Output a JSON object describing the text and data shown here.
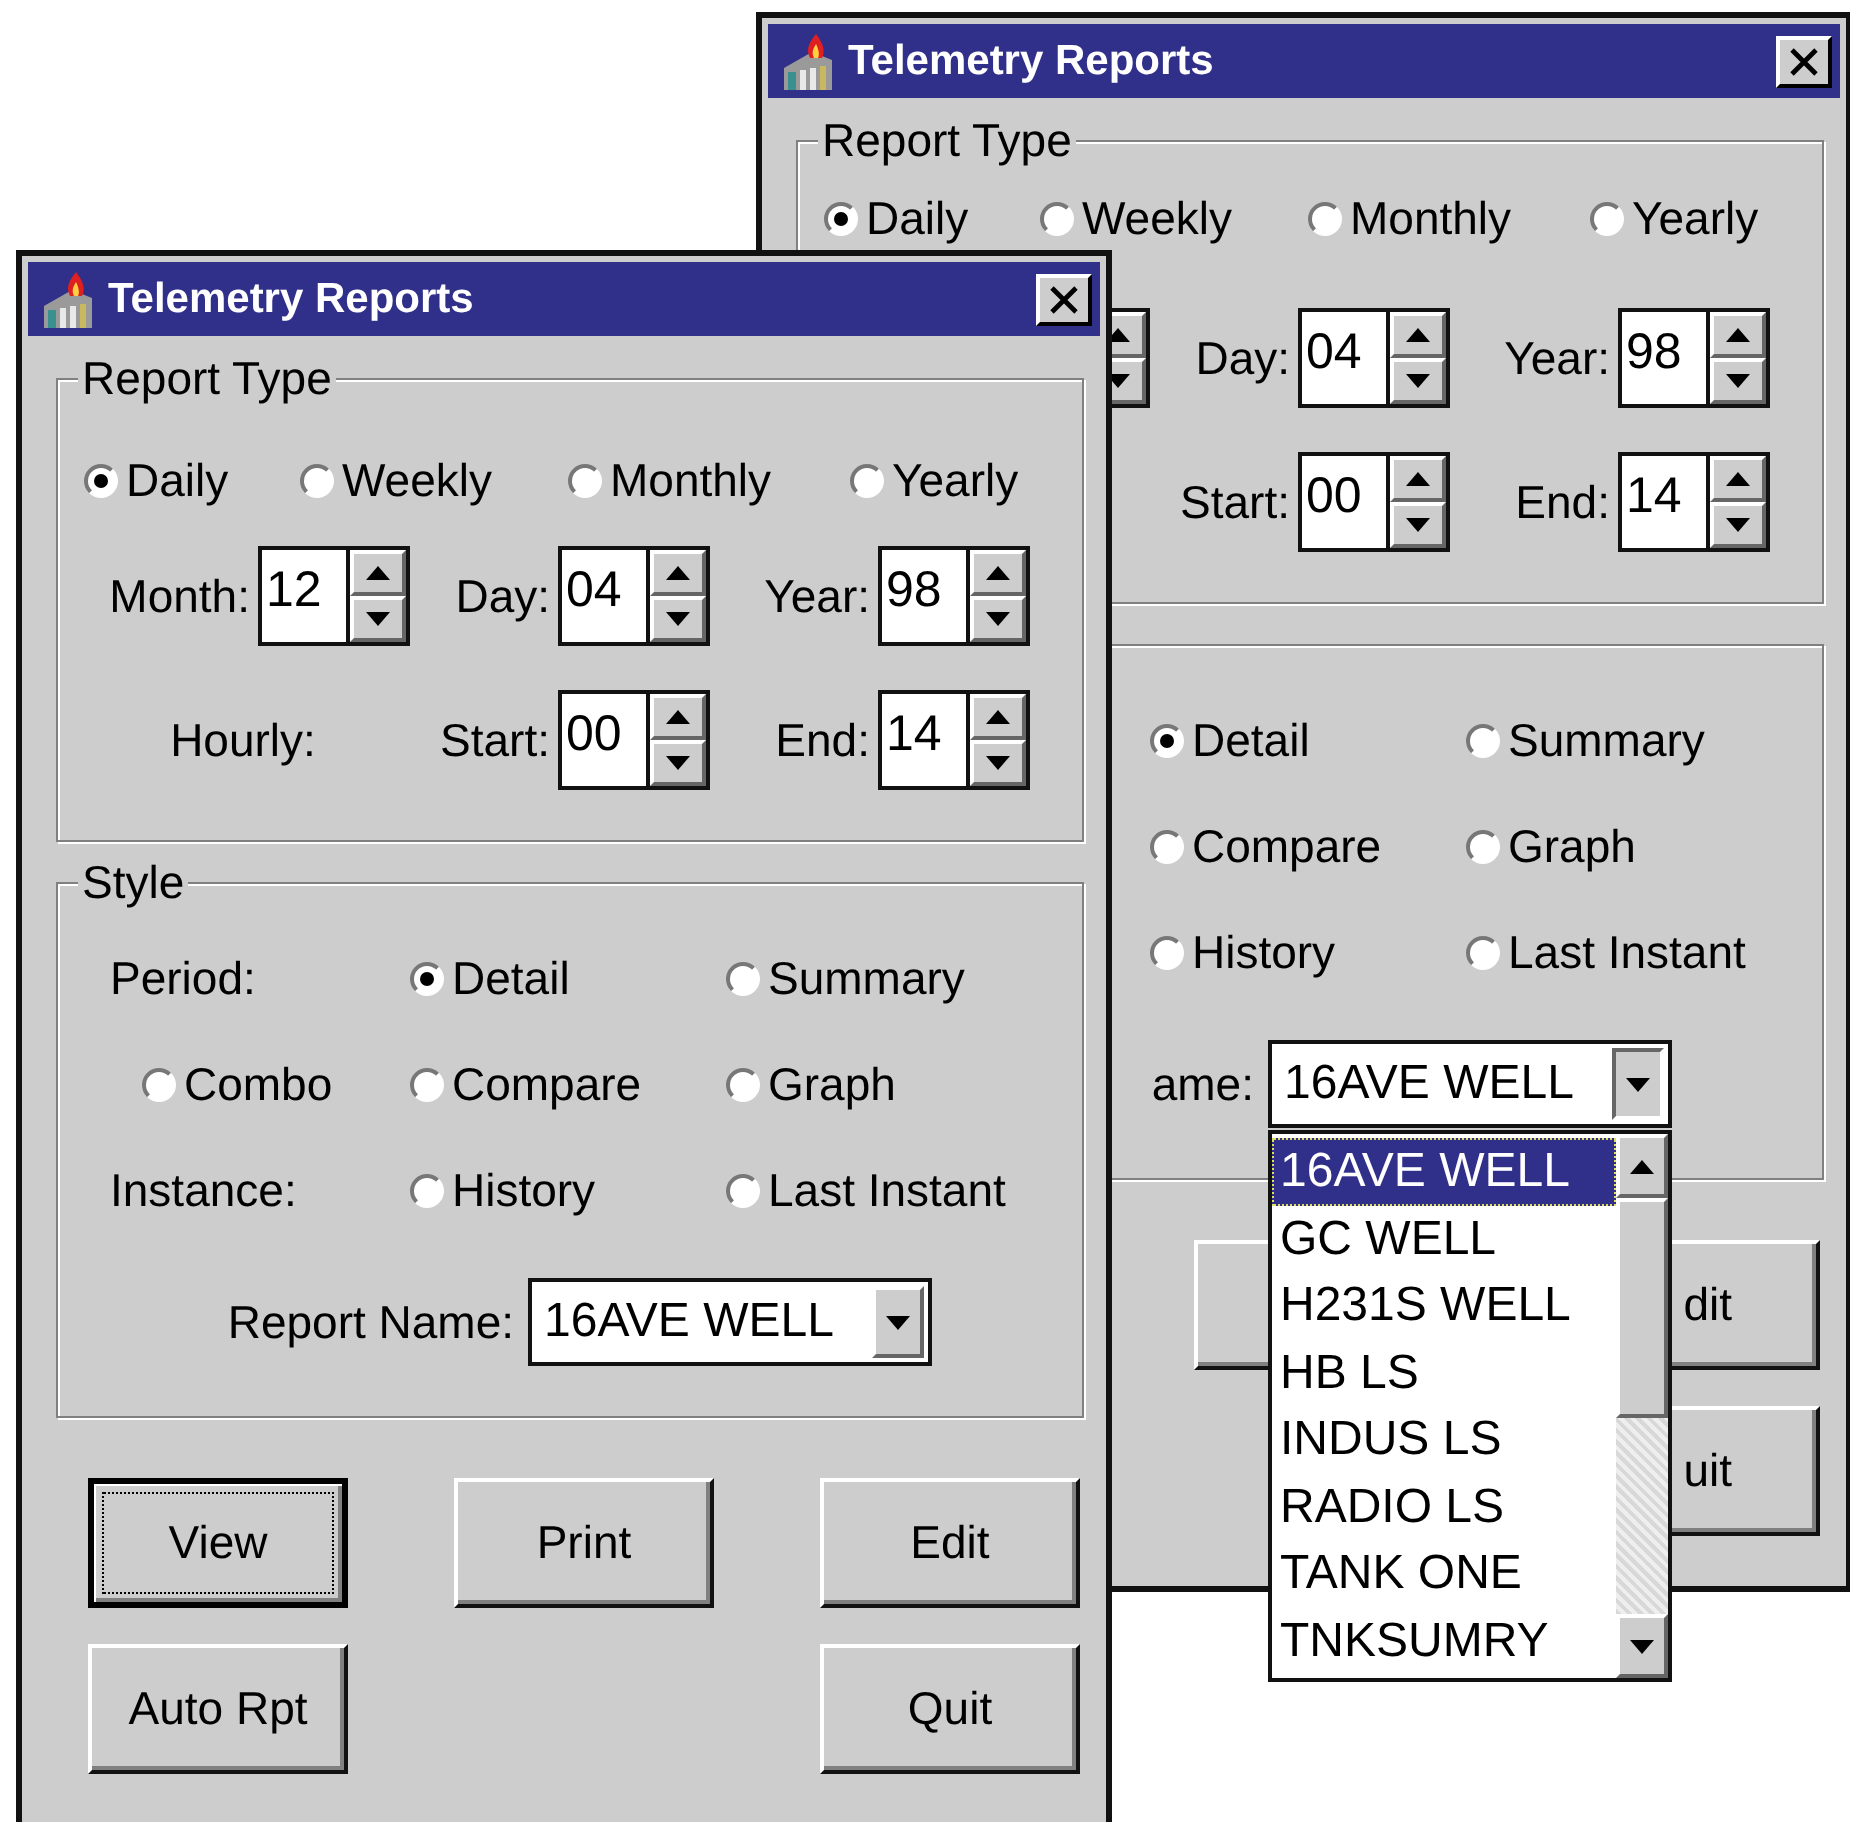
{
  "windows": [
    {
      "title": "Telemetry Reports",
      "report_type": {
        "label": "Report Type",
        "options": [
          {
            "label": "Daily",
            "selected": true
          },
          {
            "label": "Weekly",
            "selected": false
          },
          {
            "label": "Monthly",
            "selected": false
          },
          {
            "label": "Yearly",
            "selected": false
          }
        ],
        "rows": [
          [
            {
              "kind": "spinner"
            },
            {
              "kind": "spinner",
              "label": "Day:",
              "value": "04"
            },
            {
              "kind": "spinner",
              "label": "Year:",
              "value": "98"
            }
          ],
          [
            {
              "kind": "empty"
            },
            {
              "kind": "spinner",
              "label": "Start:",
              "value": "00"
            },
            {
              "kind": "spinner",
              "label": "End:",
              "value": "14"
            }
          ]
        ]
      },
      "style": {
        "rows": [
          [
            {
              "kind": "empty"
            },
            {
              "kind": "radio",
              "label": "Detail",
              "selected": true
            },
            {
              "kind": "radio",
              "label": "Summary",
              "selected": false
            }
          ],
          [
            {
              "kind": "empty"
            },
            {
              "kind": "radio",
              "label": "Compare",
              "selected": false
            },
            {
              "kind": "radio",
              "label": "Graph",
              "selected": false
            }
          ],
          [
            {
              "kind": "empty"
            },
            {
              "kind": "radio",
              "label": "History",
              "selected": false
            },
            {
              "kind": "radio",
              "label": "Last Instant",
              "selected": false
            }
          ]
        ],
        "report_name": {
          "label": "ame:",
          "value": "16AVE WELL",
          "expanded": true,
          "items": [
            {
              "label": "16AVE WELL",
              "selected": true
            },
            {
              "label": "GC WELL",
              "selected": false
            },
            {
              "label": "H231S WELL",
              "selected": false
            },
            {
              "label": "HB LS",
              "selected": false
            },
            {
              "label": "INDUS LS",
              "selected": false
            },
            {
              "label": "RADIO LS",
              "selected": false
            },
            {
              "label": "TANK ONE",
              "selected": false
            },
            {
              "label": "TNKSUMRY",
              "selected": false
            }
          ]
        }
      },
      "buttons": [
        [
          {
            "kind": "empty"
          },
          {
            "kind": "button",
            "focused": false
          },
          {
            "kind": "button",
            "label": "dit",
            "focused": false,
            "cut": true
          }
        ],
        [
          {
            "kind": "empty"
          },
          {
            "kind": "empty"
          },
          {
            "kind": "button",
            "label": "uit",
            "focused": false,
            "cut": true
          }
        ]
      ]
    },
    {
      "title": "Telemetry Reports",
      "report_type": {
        "label": "Report Type",
        "options": [
          {
            "label": "Daily",
            "selected": true
          },
          {
            "label": "Weekly",
            "selected": false
          },
          {
            "label": "Monthly",
            "selected": false
          },
          {
            "label": "Yearly",
            "selected": false
          }
        ],
        "rows": [
          [
            {
              "kind": "spinner",
              "label": "Month:",
              "value": "12"
            },
            {
              "kind": "spinner",
              "label": "Day:",
              "value": "04"
            },
            {
              "kind": "spinner",
              "label": "Year:",
              "value": "98"
            }
          ],
          [
            {
              "kind": "label",
              "label": "Hourly:"
            },
            {
              "kind": "spinner",
              "label": "Start:",
              "value": "00"
            },
            {
              "kind": "spinner",
              "label": "End:",
              "value": "14"
            }
          ]
        ]
      },
      "style": {
        "label": "Style",
        "rows": [
          [
            {
              "kind": "label",
              "label": "Period:"
            },
            {
              "kind": "radio",
              "label": "Detail",
              "selected": true
            },
            {
              "kind": "radio",
              "label": "Summary",
              "selected": false
            }
          ],
          [
            {
              "kind": "radio",
              "label": "Combo",
              "selected": false
            },
            {
              "kind": "radio",
              "label": "Compare",
              "selected": false
            },
            {
              "kind": "radio",
              "label": "Graph",
              "selected": false
            }
          ],
          [
            {
              "kind": "label",
              "label": "Instance:"
            },
            {
              "kind": "radio",
              "label": "History",
              "selected": false
            },
            {
              "kind": "radio",
              "label": "Last Instant",
              "selected": false
            }
          ]
        ],
        "report_name": {
          "label": "Report Name:",
          "value": "16AVE WELL",
          "expanded": false
        }
      },
      "buttons": [
        [
          {
            "kind": "button",
            "label": "View",
            "focused": true
          },
          {
            "kind": "button",
            "label": "Print",
            "focused": false
          },
          {
            "kind": "button",
            "label": "Edit",
            "focused": false
          }
        ],
        [
          {
            "kind": "button",
            "label": "Auto Rpt",
            "focused": false
          },
          {
            "kind": "empty"
          },
          {
            "kind": "button",
            "label": "Quit",
            "focused": false
          }
        ]
      ]
    }
  ]
}
